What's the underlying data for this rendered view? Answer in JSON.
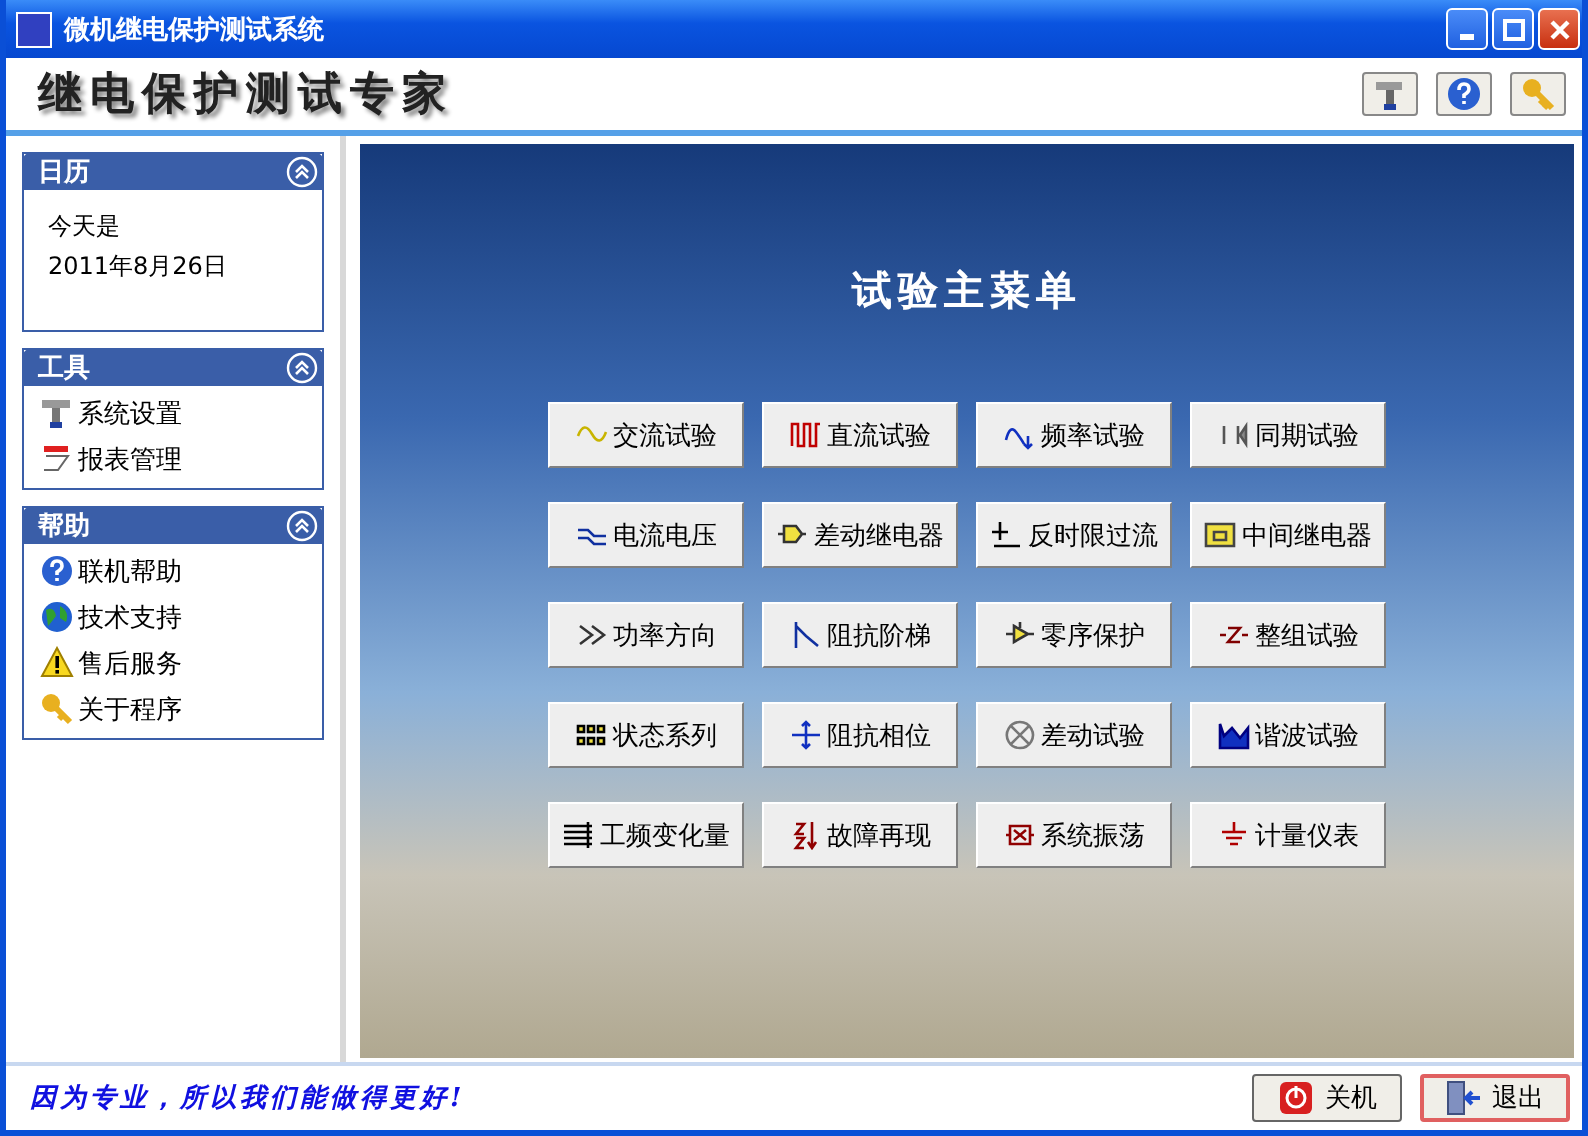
{
  "window": {
    "title": "微机继电保护测试系统"
  },
  "header": {
    "logo": "继电保护测试专家"
  },
  "sidebar": {
    "panels": [
      {
        "kind": "text",
        "title": "日历",
        "lines": [
          "今天是",
          "2011年8月26日"
        ]
      },
      {
        "kind": "links",
        "title": "工具",
        "items": [
          "系统设置",
          "报表管理"
        ]
      },
      {
        "kind": "links",
        "title": "帮助",
        "items": [
          "联机帮助",
          "技术支持",
          "售后服务",
          "关于程序"
        ]
      }
    ]
  },
  "main": {
    "title": "试验主菜单",
    "buttons": [
      "交流试验",
      "直流试验",
      "频率试验",
      "同期试验",
      "电流电压",
      "差动继电器",
      "反时限过流",
      "中间继电器",
      "功率方向",
      "阻抗阶梯",
      "零序保护",
      "整组试验",
      "状态系列",
      "阻抗相位",
      "差动试验",
      "谐波试验",
      "工频变化量",
      "故障再现",
      "系统振荡",
      "计量仪表"
    ]
  },
  "footer": {
    "slogan": "因为专业，所以我们能做得更好!",
    "buttons": [
      "关机",
      "退出"
    ]
  }
}
